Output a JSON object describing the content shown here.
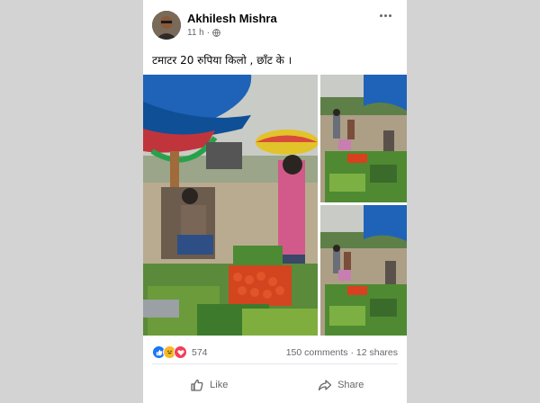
{
  "post": {
    "author": "Akhilesh Mishra",
    "time": "11 h",
    "separator": "·",
    "privacy_icon": "globe-icon",
    "caption": "टमाटर 20 रुपिया किलो , छाँट के ।"
  },
  "photos": [
    {
      "description_icon": "vegetable-market-photo"
    },
    {
      "description_icon": "vegetable-market-photo"
    },
    {
      "description_icon": "vegetable-market-photo"
    }
  ],
  "stats": {
    "reaction_icons": [
      "like-icon",
      "haha-icon",
      "love-icon"
    ],
    "reaction_count": "574",
    "comments_shares": "150 comments · 12 shares"
  },
  "actions": {
    "like_label": "Like",
    "share_label": "Share"
  },
  "colors": {
    "accent": "#1877f2",
    "text_secondary": "#65676b",
    "background": "#d3d3d3"
  }
}
